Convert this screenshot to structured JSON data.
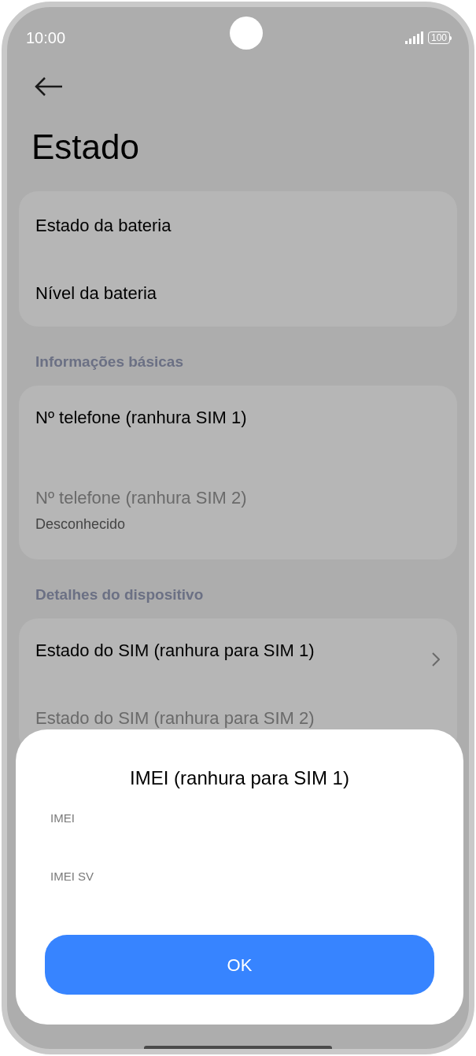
{
  "status_bar": {
    "time": "10:00",
    "battery": "100"
  },
  "header": {
    "title": "Estado"
  },
  "groups": [
    {
      "items": [
        {
          "kind": "info",
          "title": "Estado da bateria",
          "disabled": false
        },
        {
          "kind": "info",
          "title": "Nível da bateria",
          "disabled": false
        }
      ]
    },
    {
      "heading": "Informações básicas",
      "items": [
        {
          "kind": "info",
          "title": "Nº telefone (ranhura SIM 1)",
          "disabled": false
        },
        {
          "kind": "info",
          "title": "Nº telefone (ranhura SIM 2)",
          "subtitle": "Desconhecido",
          "disabled": true
        }
      ]
    },
    {
      "heading": "Detalhes do dispositivo",
      "items": [
        {
          "kind": "link",
          "title": "Estado do SIM (ranhura para SIM 1)",
          "disabled": false
        },
        {
          "kind": "info",
          "title": "Estado do SIM (ranhura para SIM 2)",
          "disabled": true
        }
      ]
    }
  ],
  "dialog": {
    "title": "IMEI (ranhura para SIM 1)",
    "fields": [
      {
        "label": "IMEI"
      },
      {
        "label": "IMEI SV"
      }
    ],
    "button": "OK"
  }
}
